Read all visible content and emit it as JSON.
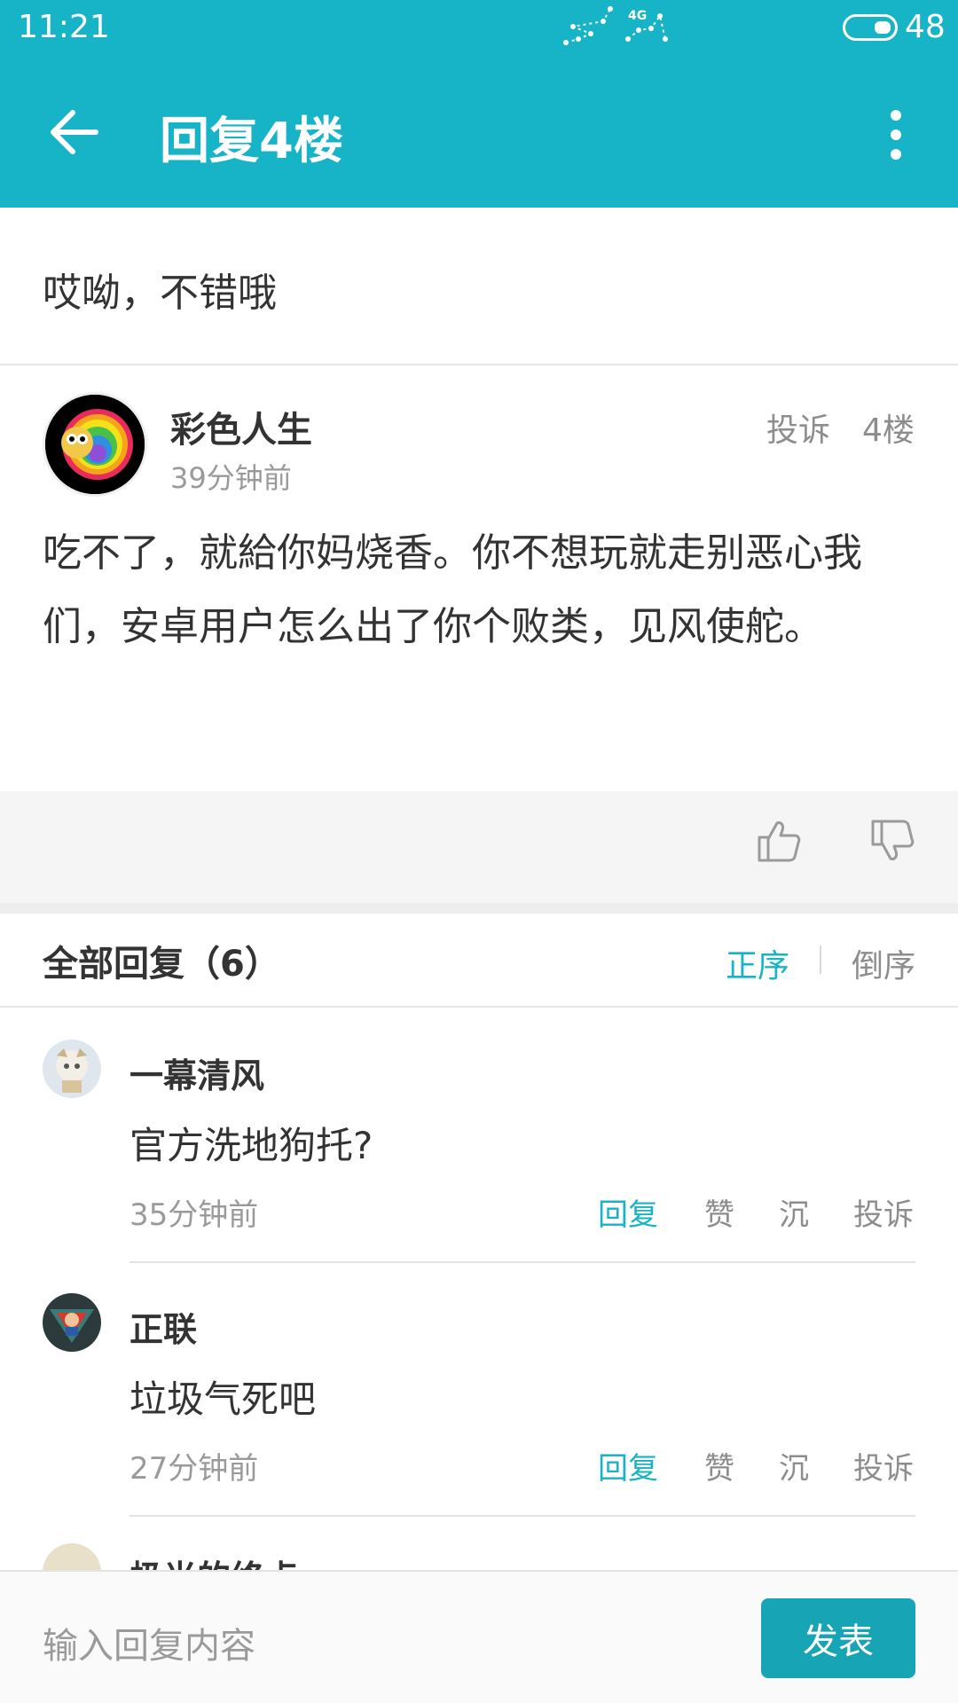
{
  "status_bar": {
    "time": "11:21",
    "network": "4G",
    "battery": "48"
  },
  "app_bar": {
    "title": "回复4楼"
  },
  "quoted": {
    "text": "哎呦，不错哦"
  },
  "post": {
    "author": "彩色人生",
    "time": "39分钟前",
    "report_label": "投诉",
    "floor": "4楼",
    "content": "吃不了，就給你妈烧香。你不想玩就走别恶心我们，安卓用户怎么出了你个败类，见风使舵。"
  },
  "replies_header": {
    "label": "全部回复（6）",
    "sort_asc": "正序",
    "sort_desc": "倒序"
  },
  "replies": [
    {
      "author": "一幕清风",
      "text": "官方洗地狗托?",
      "time": "35分钟前",
      "reply_label": "回复",
      "like_label": "赞",
      "sink_label": "沉",
      "report_label": "投诉"
    },
    {
      "author": "正联",
      "text": "垃圾气死吧",
      "time": "27分钟前",
      "reply_label": "回复",
      "like_label": "赞",
      "sink_label": "沉",
      "report_label": "投诉"
    }
  ],
  "partial_reply": {
    "author": "极光的终点"
  },
  "composer": {
    "placeholder": "输入回复内容",
    "send_label": "发表"
  },
  "colors": {
    "accent": "#17b3c6",
    "send_button": "#17a5b6"
  }
}
